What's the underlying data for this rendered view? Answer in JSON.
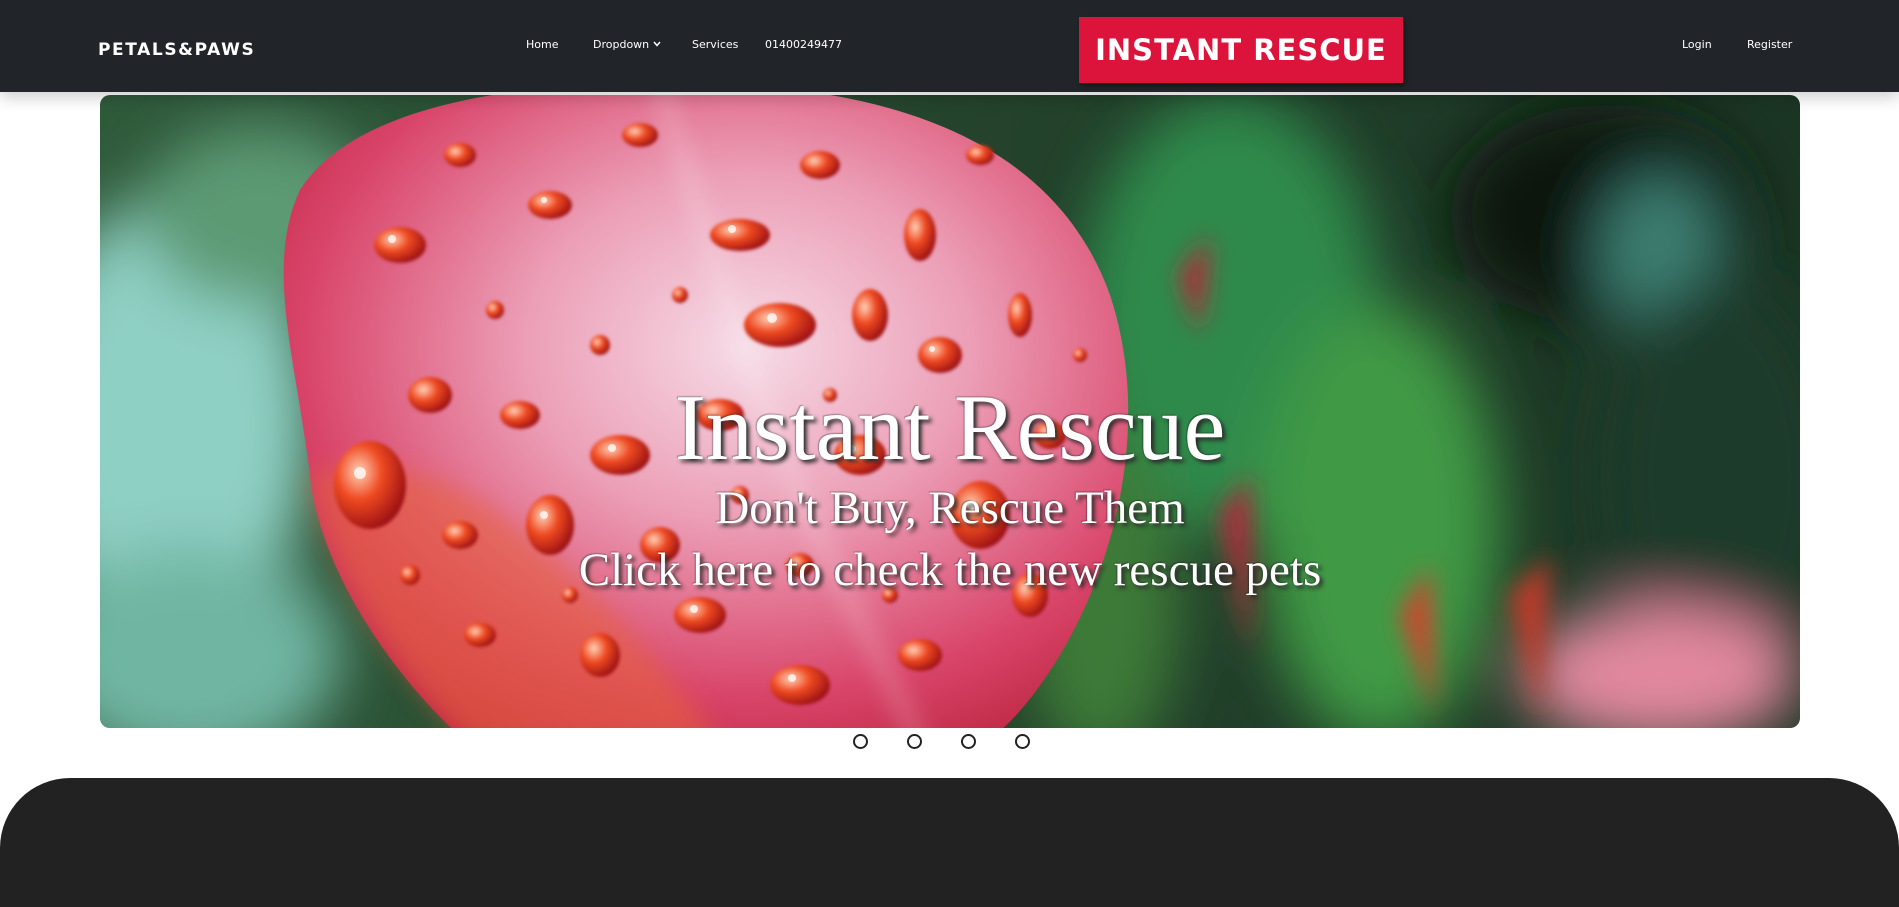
{
  "navbar": {
    "brand": "PETALS&PAWS",
    "links": {
      "home": "Home",
      "dropdown": "Dropdown",
      "services": "Services",
      "phone": "01400249477",
      "login": "Login",
      "register": "Register"
    },
    "cta": "INSTANT RESCUE"
  },
  "hero": {
    "title": "Instant Rescue",
    "subtitle": "Don't Buy, Rescue Them",
    "link_text": "Click here to check the new rescue pets"
  },
  "carousel": {
    "slide_count": 4,
    "indicators": [
      "",
      "",
      "",
      ""
    ]
  },
  "colors": {
    "navbar_bg": "#212529",
    "cta_bg": "#dc143c",
    "footer_bg": "#222222"
  }
}
